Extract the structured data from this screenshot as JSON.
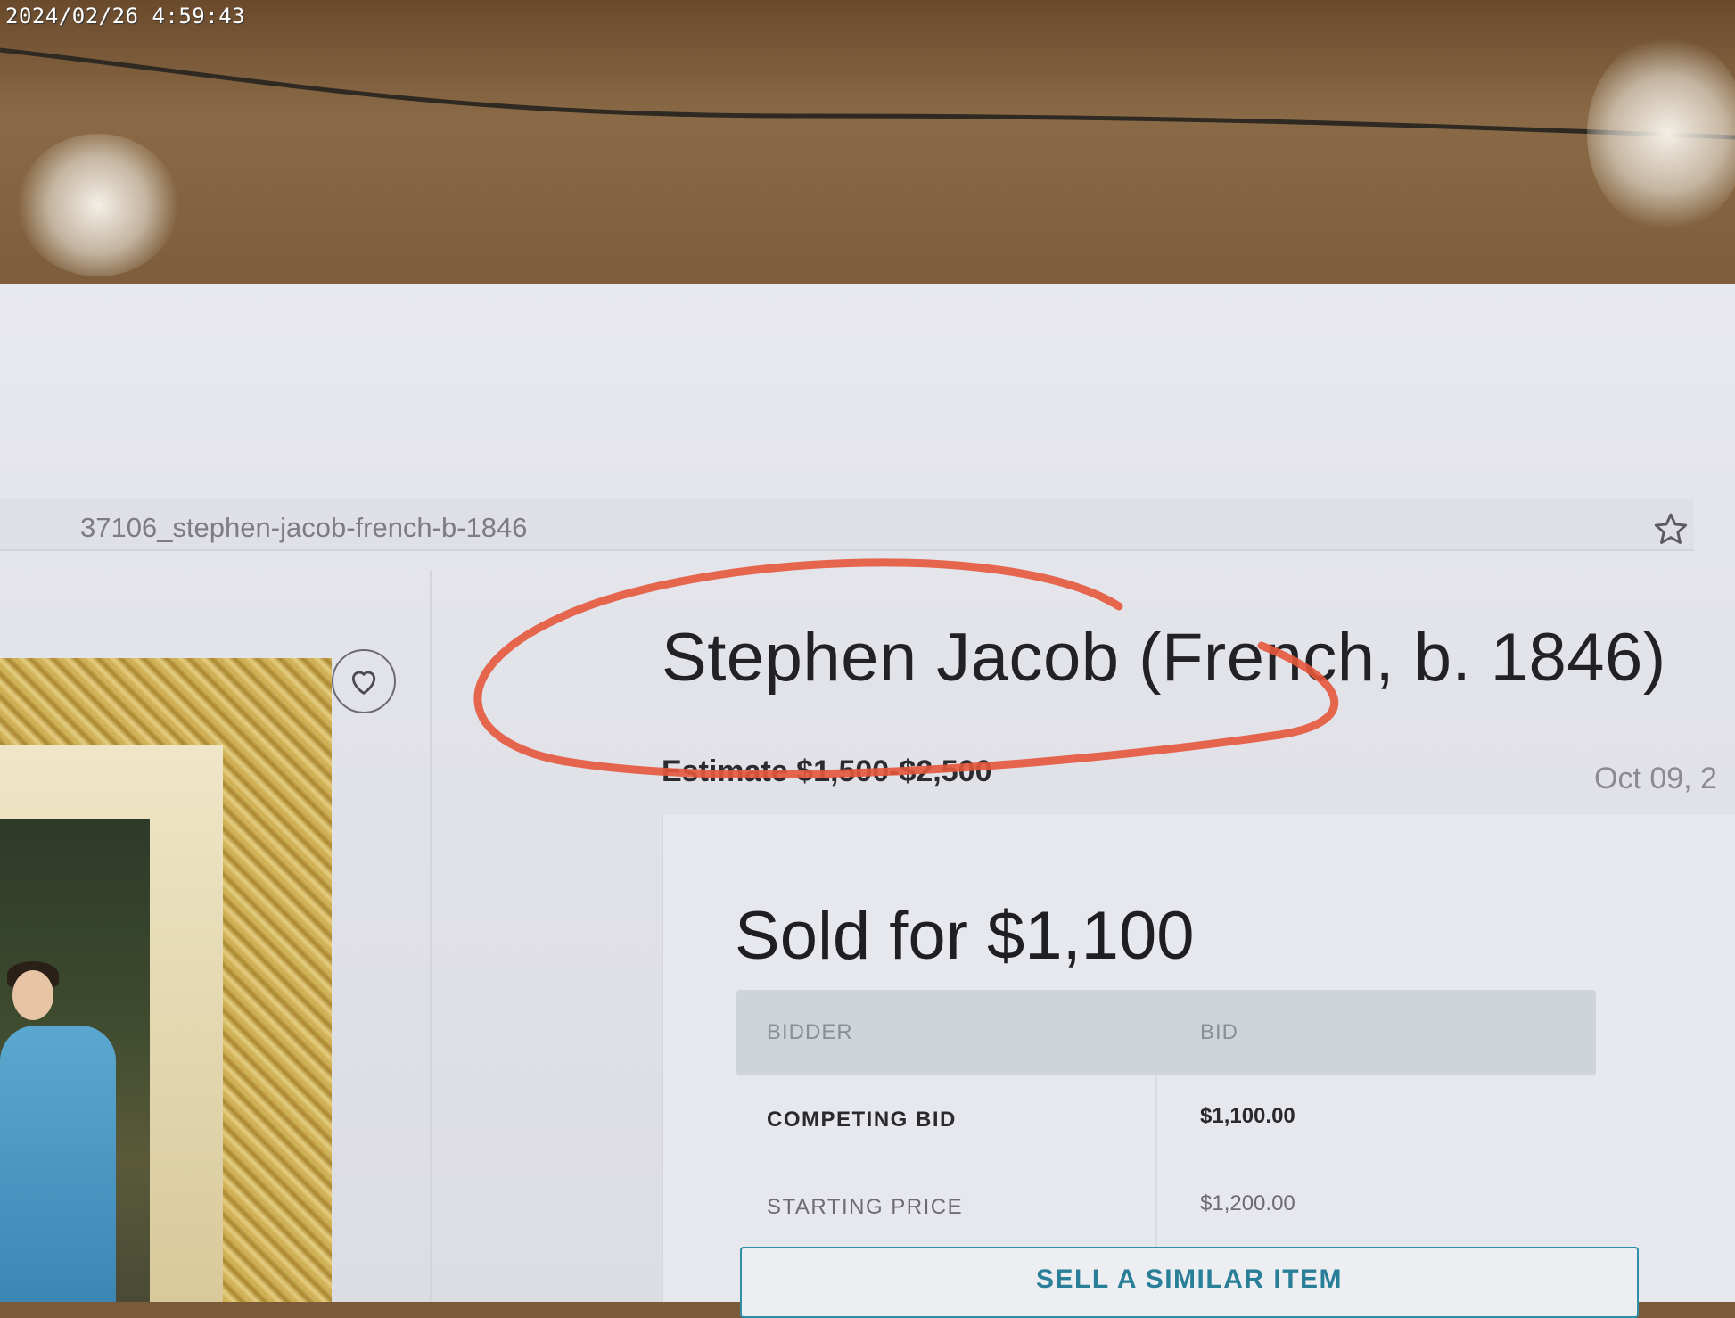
{
  "photo": {
    "timestamp": "2024/02/26 4:59:43"
  },
  "browser": {
    "url_fragment": "37106_stephen-jacob-french-b-1846",
    "bookmark_icon": "star-icon"
  },
  "lot": {
    "title": "Stephen Jacob (French, b. 1846)",
    "estimate": "Estimate $1,500-$2,500",
    "date": "Oct 09, 2",
    "favorite_icon": "heart-icon",
    "annotation_color": "#e0523a"
  },
  "sale": {
    "sold_label": "Sold for $1,100",
    "table": {
      "headers": [
        "BIDDER",
        "BID"
      ],
      "rows": [
        {
          "bidder": "COMPETING BID",
          "bid": "$1,100.00"
        },
        {
          "bidder": "STARTING PRICE",
          "bid": "$1,200.00"
        }
      ]
    },
    "cta": "SELL A SIMILAR ITEM"
  }
}
